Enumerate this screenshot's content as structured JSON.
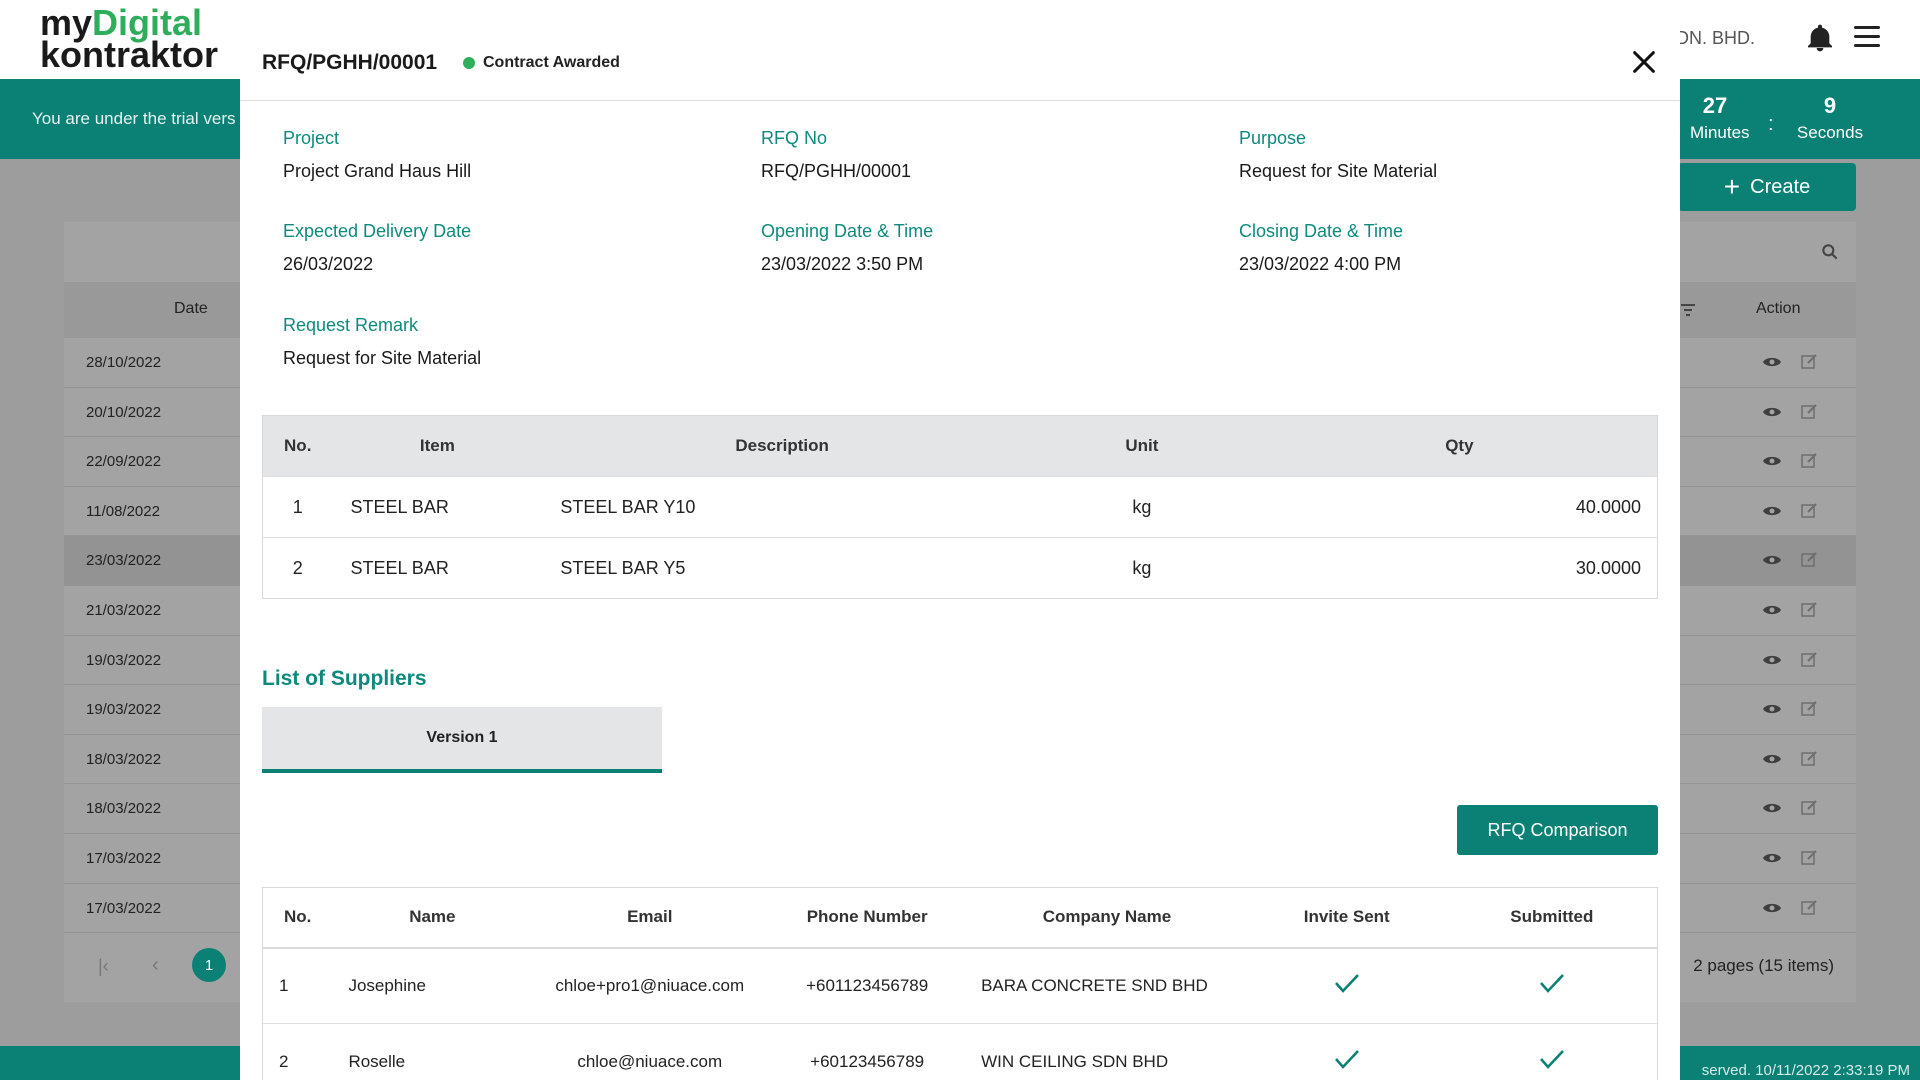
{
  "app": {
    "logo_line1_a": "my",
    "logo_line1_b": "Digital",
    "logo_line2": "kontraktor",
    "company": "L SDN. BHD."
  },
  "trial": {
    "text": "You are under the trial vers",
    "minutes_value": "27",
    "minutes_label": "Minutes",
    "separator": ":",
    "seconds_value": "9",
    "seconds_label": "Seconds"
  },
  "toolbar": {
    "create_label": "Create"
  },
  "list": {
    "date_header": "Date",
    "action_header": "Action",
    "rows": [
      "28/10/2022",
      "20/10/2022",
      "22/09/2022",
      "11/08/2022",
      "23/03/2022",
      "21/03/2022",
      "19/03/2022",
      "19/03/2022",
      "18/03/2022",
      "18/03/2022",
      "17/03/2022",
      "17/03/2022"
    ],
    "pager_current": "1",
    "pager_info": "2 pages (15 items)"
  },
  "footer": {
    "text": "served. 10/11/2022 2:33:19 PM"
  },
  "modal": {
    "title": "RFQ/PGHH/00001",
    "status": "Contract Awarded",
    "fields": {
      "project_label": "Project",
      "project_value": "Project Grand Haus Hill",
      "rfq_no_label": "RFQ No",
      "rfq_no_value": "RFQ/PGHH/00001",
      "purpose_label": "Purpose",
      "purpose_value": "Request for Site Material",
      "expected_delivery_label": "Expected Delivery Date",
      "expected_delivery_value": "26/03/2022",
      "opening_label": "Opening Date & Time",
      "opening_value": "23/03/2022 3:50 PM",
      "closing_label": "Closing Date & Time",
      "closing_value": "23/03/2022 4:00 PM",
      "remark_label": "Request Remark",
      "remark_value": "Request for Site Material"
    },
    "items_table": {
      "headers": [
        "No.",
        "Item",
        "Description",
        "Unit",
        "Qty"
      ],
      "rows": [
        [
          "1",
          "STEEL BAR",
          "STEEL BAR Y10",
          "kg",
          "40.0000"
        ],
        [
          "2",
          "STEEL BAR",
          "STEEL BAR Y5",
          "kg",
          "30.0000"
        ]
      ]
    },
    "suppliers_title": "List of Suppliers",
    "version_tab": "Version 1",
    "comparison_button": "RFQ Comparison",
    "suppliers_table": {
      "headers": [
        "No.",
        "Name",
        "Email",
        "Phone Number",
        "Company Name",
        "Invite Sent",
        "Submitted"
      ],
      "rows": [
        [
          "1",
          "Josephine",
          "chloe+pro1@niuace.com",
          "+601123456789",
          "BARA CONCRETE SND BHD"
        ],
        [
          "2",
          "Roselle",
          "chloe@niuace.com",
          "+60123456789",
          "WIN CEILING SDN BHD"
        ]
      ]
    }
  }
}
